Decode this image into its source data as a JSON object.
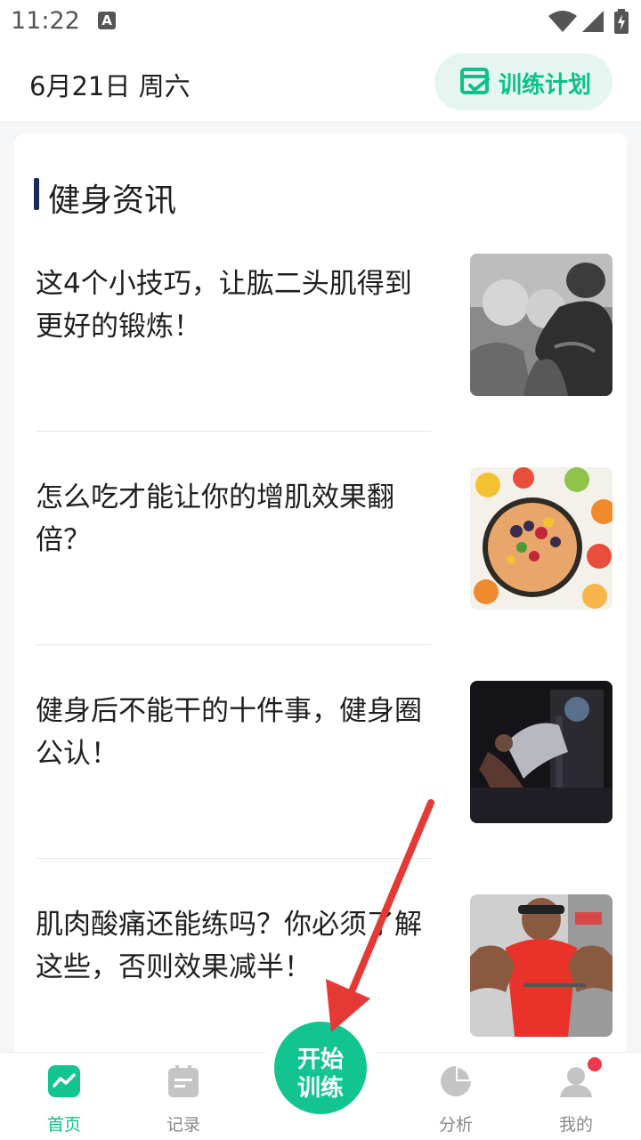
{
  "status_bar": {
    "time": "11:22",
    "notification_icon": "a-icon",
    "icons": [
      "wifi-icon",
      "signal-icon",
      "battery-charging-icon"
    ]
  },
  "header": {
    "date": "6月21日 周六",
    "plan_button": {
      "label": "训练计划",
      "icon": "calendar-check-icon"
    }
  },
  "news": {
    "section_title": "健身资讯",
    "articles": [
      {
        "title": "这4个小技巧，让肱二头肌得到更好的锻炼！",
        "thumbnail": "bicep-flex-photo"
      },
      {
        "title": "怎么吃才能让你的增肌效果翻倍？",
        "thumbnail": "fruit-bowl-photo"
      },
      {
        "title": "健身后不能干的十件事，健身圈公认！",
        "thumbnail": "leg-press-gym-photo"
      },
      {
        "title": "肌肉酸痛还能练吗？你必须了解这些，否则效果减半！",
        "thumbnail": "cable-machine-athlete-photo"
      }
    ]
  },
  "bottom_nav": {
    "tabs": [
      {
        "label": "首页",
        "icon": "home-chart-icon",
        "active": true
      },
      {
        "label": "记录",
        "icon": "notes-icon",
        "active": false
      },
      {
        "label": "分析",
        "icon": "pie-chart-icon",
        "active": false
      },
      {
        "label": "我的",
        "icon": "user-icon",
        "active": false,
        "badge": true
      }
    ],
    "start_button": {
      "line1": "开始",
      "line2": "训练"
    }
  },
  "colors": {
    "accent": "#12c48f",
    "accent_light": "#e4f6ef",
    "title_bar": "#1a2a5c",
    "badge": "#f0384e",
    "annotation_arrow": "#e53935"
  }
}
